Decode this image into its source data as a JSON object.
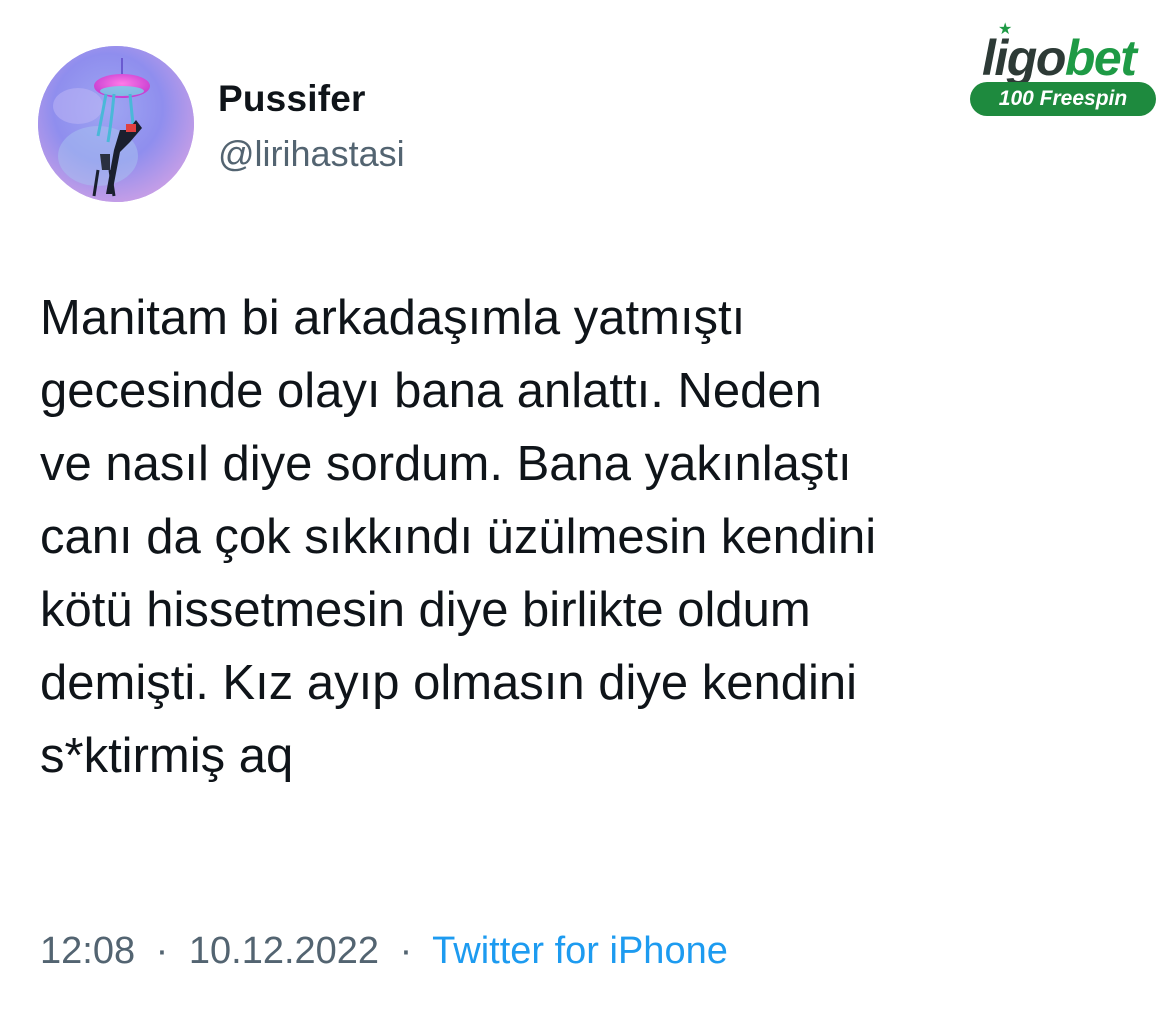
{
  "author": {
    "display_name": "Pussifer",
    "handle": "@lirihastasi"
  },
  "brand": {
    "name_part1": "ligo",
    "name_part2": "bet",
    "badge": "100 Freespin",
    "color": "#1e9a45"
  },
  "tweet": {
    "lines": [
      "Manitam bi arkadaşımla yatmıştı",
      "gecesinde olayı bana anlattı. Neden",
      "ve nasıl diye sordum. Bana yakınlaştı",
      "canı da çok sıkkındı üzülmesin kendini",
      "kötü hissetmesin diye birlikte oldum",
      "demişti. Kız ayıp olmasın diye kendini",
      "s*ktirmiş aq"
    ]
  },
  "meta": {
    "time": "12:08",
    "separator": "·",
    "date": "10.12.2022",
    "source": "Twitter for iPhone"
  },
  "colors": {
    "text": "#0f1419",
    "secondary": "#536471",
    "link": "#1d9bf0"
  }
}
